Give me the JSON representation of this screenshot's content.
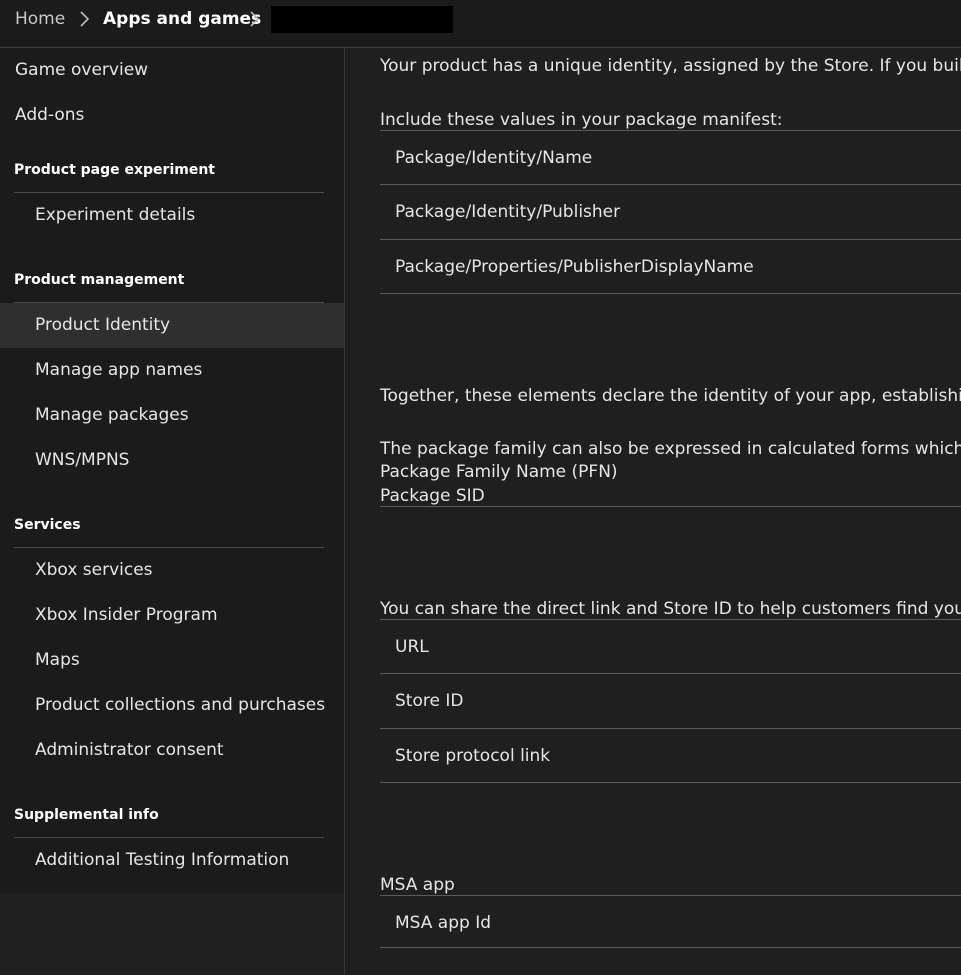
{
  "breadcrumb": {
    "home": "Home",
    "apps": "Apps and games"
  },
  "sidebar": {
    "top_items": [
      "Game overview",
      "Add-ons"
    ],
    "sections": [
      {
        "header": "Product page experiment",
        "items": [
          "Experiment details"
        ]
      },
      {
        "header": "Product management",
        "items": [
          "Product Identity",
          "Manage app names",
          "Manage packages",
          "WNS/MPNS"
        ],
        "selected": "Product Identity"
      },
      {
        "header": "Services",
        "items": [
          "Xbox services",
          "Xbox Insider Program",
          "Maps",
          "Product collections and purchases",
          "Administrator consent"
        ]
      },
      {
        "header": "Supplemental info",
        "items": [
          "Additional Testing Information"
        ]
      }
    ]
  },
  "main": {
    "intro": "Your product has a unique identity, assigned by the Store. If you build your",
    "manifest_heading": "Include these values in your package manifest:",
    "manifest_rows": [
      "Package/Identity/Name",
      "Package/Identity/Publisher",
      "Package/Properties/PublisherDisplayName"
    ],
    "together_text": "Together, these elements declare the identity of your app, establishing the \"",
    "family_text": "The package family can also be expressed in calculated forms which are not",
    "pfn_label": "Package Family Name (PFN)",
    "sid_label": "Package SID",
    "share_text": "You can share the direct link and Store ID to help customers find your app i",
    "link_rows": [
      "URL",
      "Store ID",
      "Store protocol link"
    ],
    "msa_heading": "MSA app",
    "msa_rows": [
      "MSA app Id"
    ]
  }
}
